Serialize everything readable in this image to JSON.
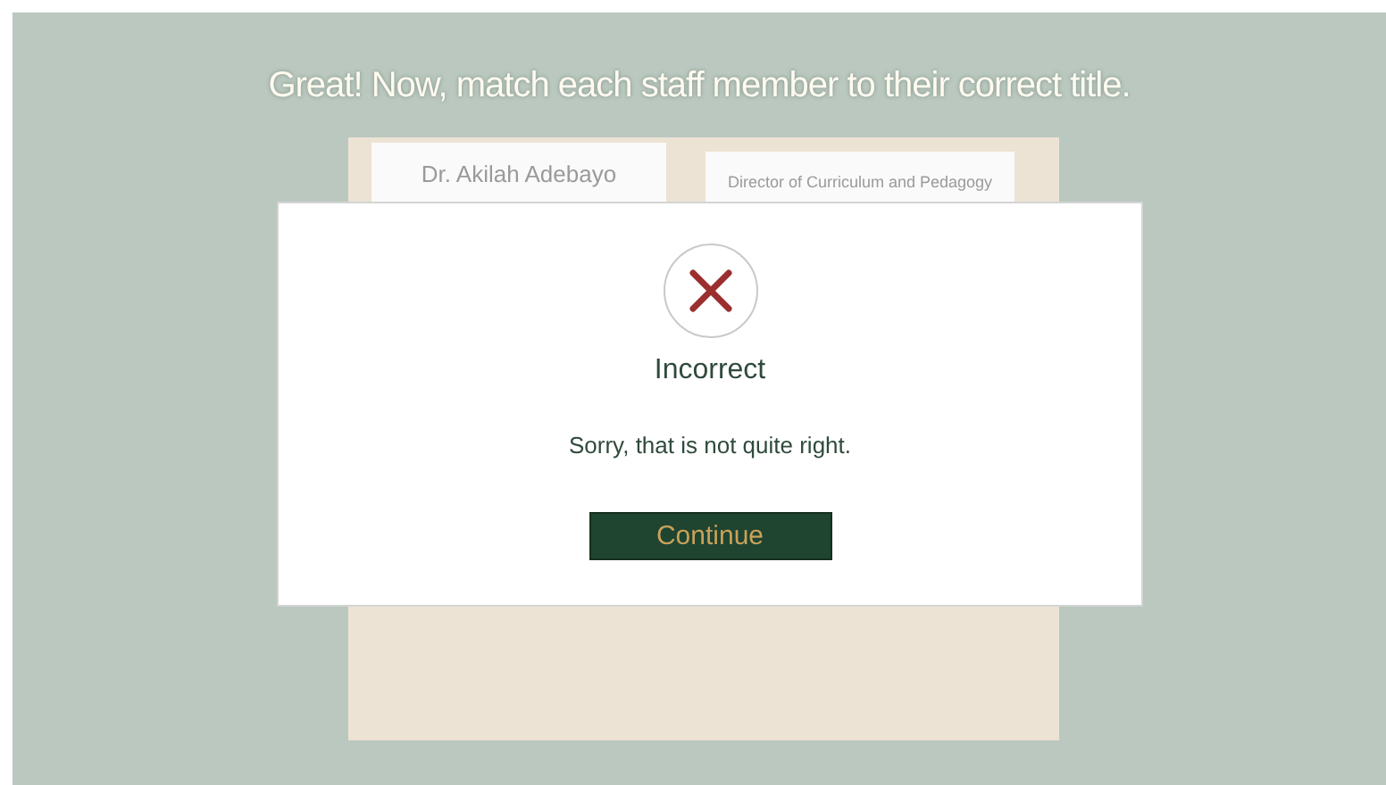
{
  "instruction": "Great! Now, match each staff member to their correct title.",
  "cards": [
    {
      "kind": "name",
      "text": "Dr. Akilah Adebayo"
    },
    {
      "kind": "title",
      "text": "Director of Curriculum and Pedagogy"
    }
  ],
  "dialog": {
    "heading": "Incorrect",
    "message": "Sorry, that is not quite right.",
    "button": "Continue"
  }
}
